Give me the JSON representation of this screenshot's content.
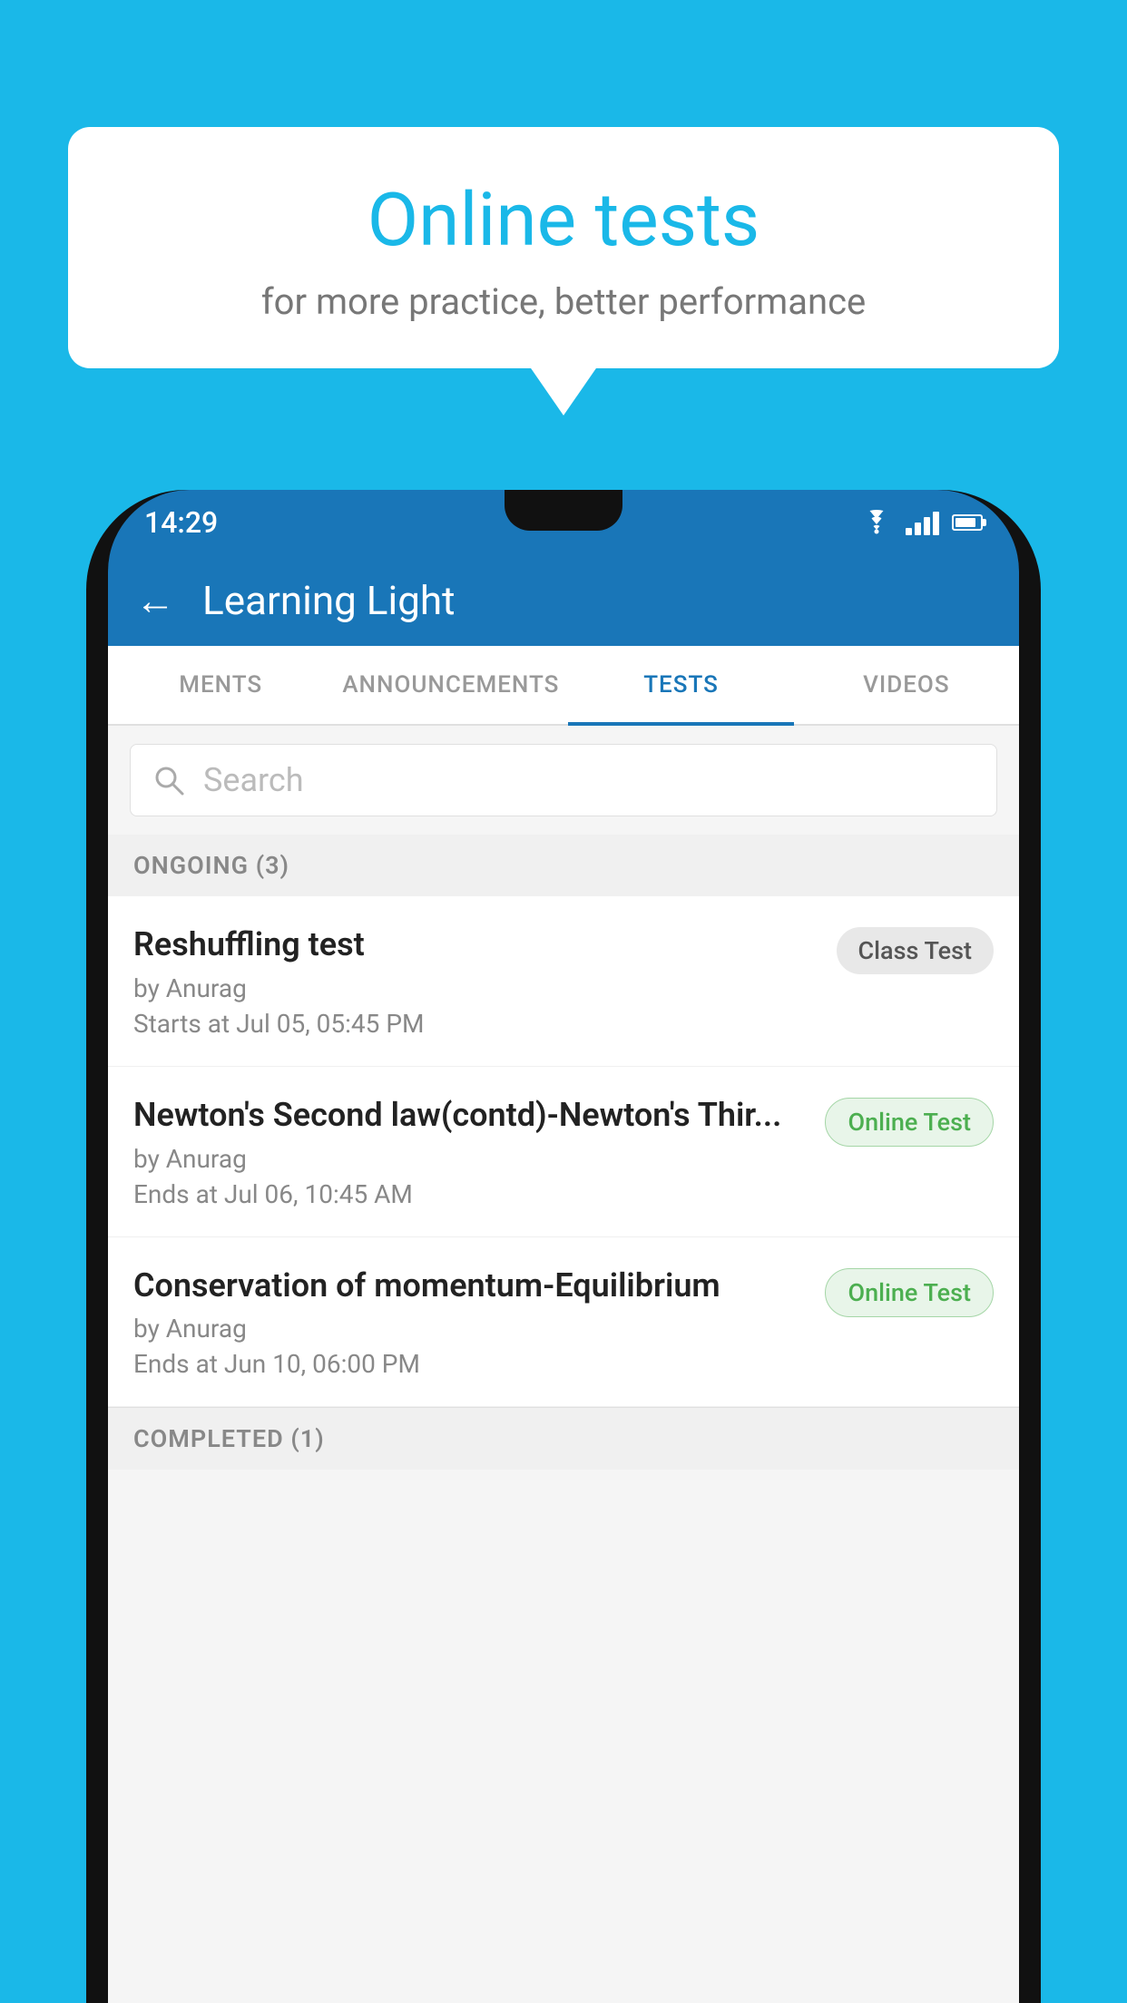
{
  "background": {
    "color": "#1ab8e8"
  },
  "speech_bubble": {
    "title": "Online tests",
    "subtitle": "for more practice, better performance"
  },
  "status_bar": {
    "time": "14:29"
  },
  "app_header": {
    "title": "Learning Light",
    "back_label": "←"
  },
  "tabs": [
    {
      "label": "MENTS",
      "active": false
    },
    {
      "label": "ANNOUNCEMENTS",
      "active": false
    },
    {
      "label": "TESTS",
      "active": true
    },
    {
      "label": "VIDEOS",
      "active": false
    }
  ],
  "search": {
    "placeholder": "Search"
  },
  "ongoing_section": {
    "label": "ONGOING (3)"
  },
  "tests": [
    {
      "name": "Reshuffling test",
      "by": "by Anurag",
      "time": "Starts at  Jul 05, 05:45 PM",
      "badge": "Class Test",
      "badge_type": "class"
    },
    {
      "name": "Newton's Second law(contd)-Newton's Thir...",
      "by": "by Anurag",
      "time": "Ends at  Jul 06, 10:45 AM",
      "badge": "Online Test",
      "badge_type": "online"
    },
    {
      "name": "Conservation of momentum-Equilibrium",
      "by": "by Anurag",
      "time": "Ends at  Jun 10, 06:00 PM",
      "badge": "Online Test",
      "badge_type": "online"
    }
  ],
  "completed_section": {
    "label": "COMPLETED (1)"
  }
}
